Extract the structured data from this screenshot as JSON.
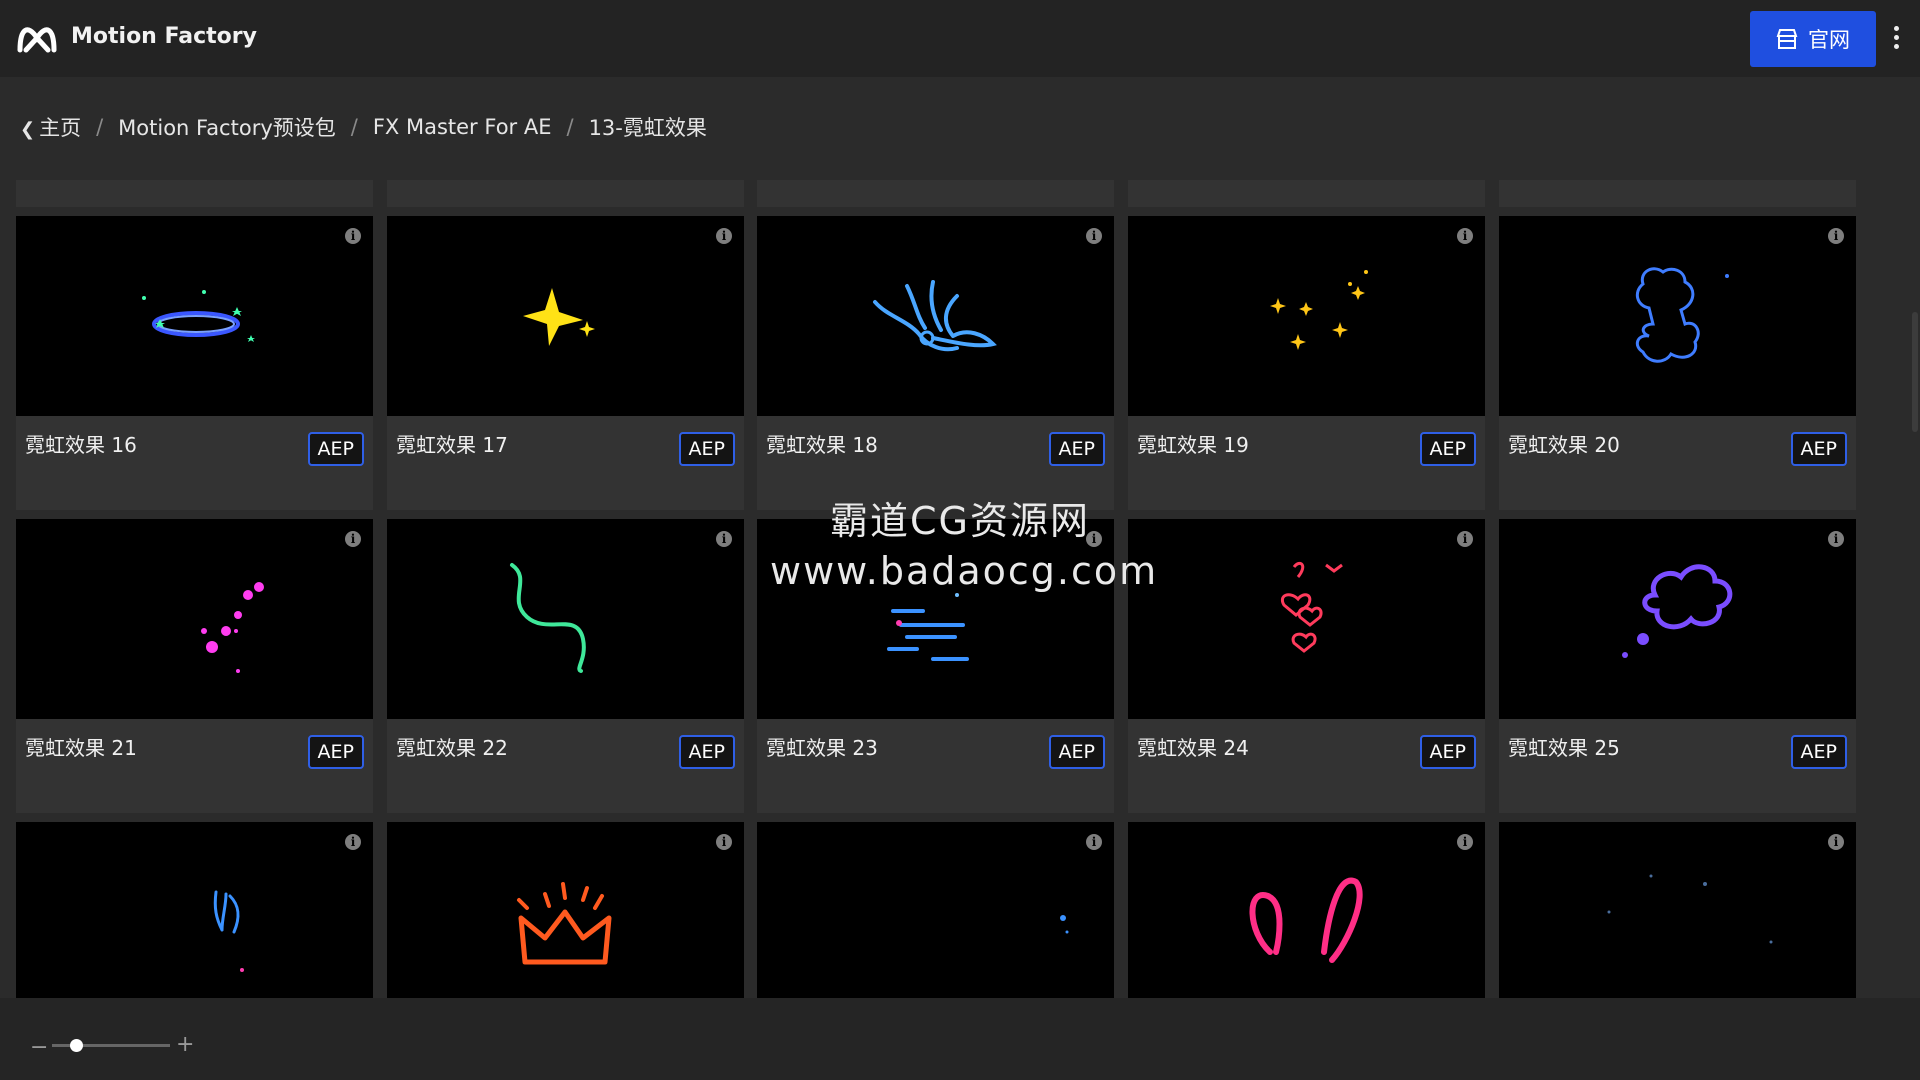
{
  "app": {
    "title": "Motion Factory",
    "site_button": "官网"
  },
  "breadcrumb": [
    "主页",
    "Motion Factory预设包",
    "FX Master For AE",
    "13-霓虹效果"
  ],
  "cards": [
    {
      "name": "霓虹效果 16",
      "badge": "AEP",
      "preview": "neon-ring-stars"
    },
    {
      "name": "霓虹效果 17",
      "badge": "AEP",
      "preview": "neon-sparkle-star"
    },
    {
      "name": "霓虹效果 18",
      "badge": "AEP",
      "preview": "neon-splash"
    },
    {
      "name": "霓虹效果 19",
      "badge": "AEP",
      "preview": "neon-twinkles"
    },
    {
      "name": "霓虹效果 20",
      "badge": "AEP",
      "preview": "neon-explosion"
    },
    {
      "name": "霓虹效果 21",
      "badge": "AEP",
      "preview": "neon-dots"
    },
    {
      "name": "霓虹效果 22",
      "badge": "AEP",
      "preview": "neon-squiggle"
    },
    {
      "name": "霓虹效果 23",
      "badge": "AEP",
      "preview": "neon-speed-lines"
    },
    {
      "name": "霓虹效果 24",
      "badge": "AEP",
      "preview": "neon-hearts"
    },
    {
      "name": "霓虹效果 25",
      "badge": "AEP",
      "preview": "neon-thought-bubble"
    },
    {
      "preview": "neon-lines-small"
    },
    {
      "preview": "neon-crown"
    },
    {
      "preview": "neon-dot-small"
    },
    {
      "preview": "neon-bunny-ears"
    },
    {
      "preview": "neon-faint-stars"
    }
  ],
  "watermark": {
    "line1": "霸道CG资源网",
    "line2": "www.badaocg.com"
  },
  "zoom": {
    "minus": "−",
    "plus": "+",
    "level": 0.2
  },
  "colors": {
    "accent": "#1f4fe0",
    "badge_border": "#2f5fe6"
  }
}
